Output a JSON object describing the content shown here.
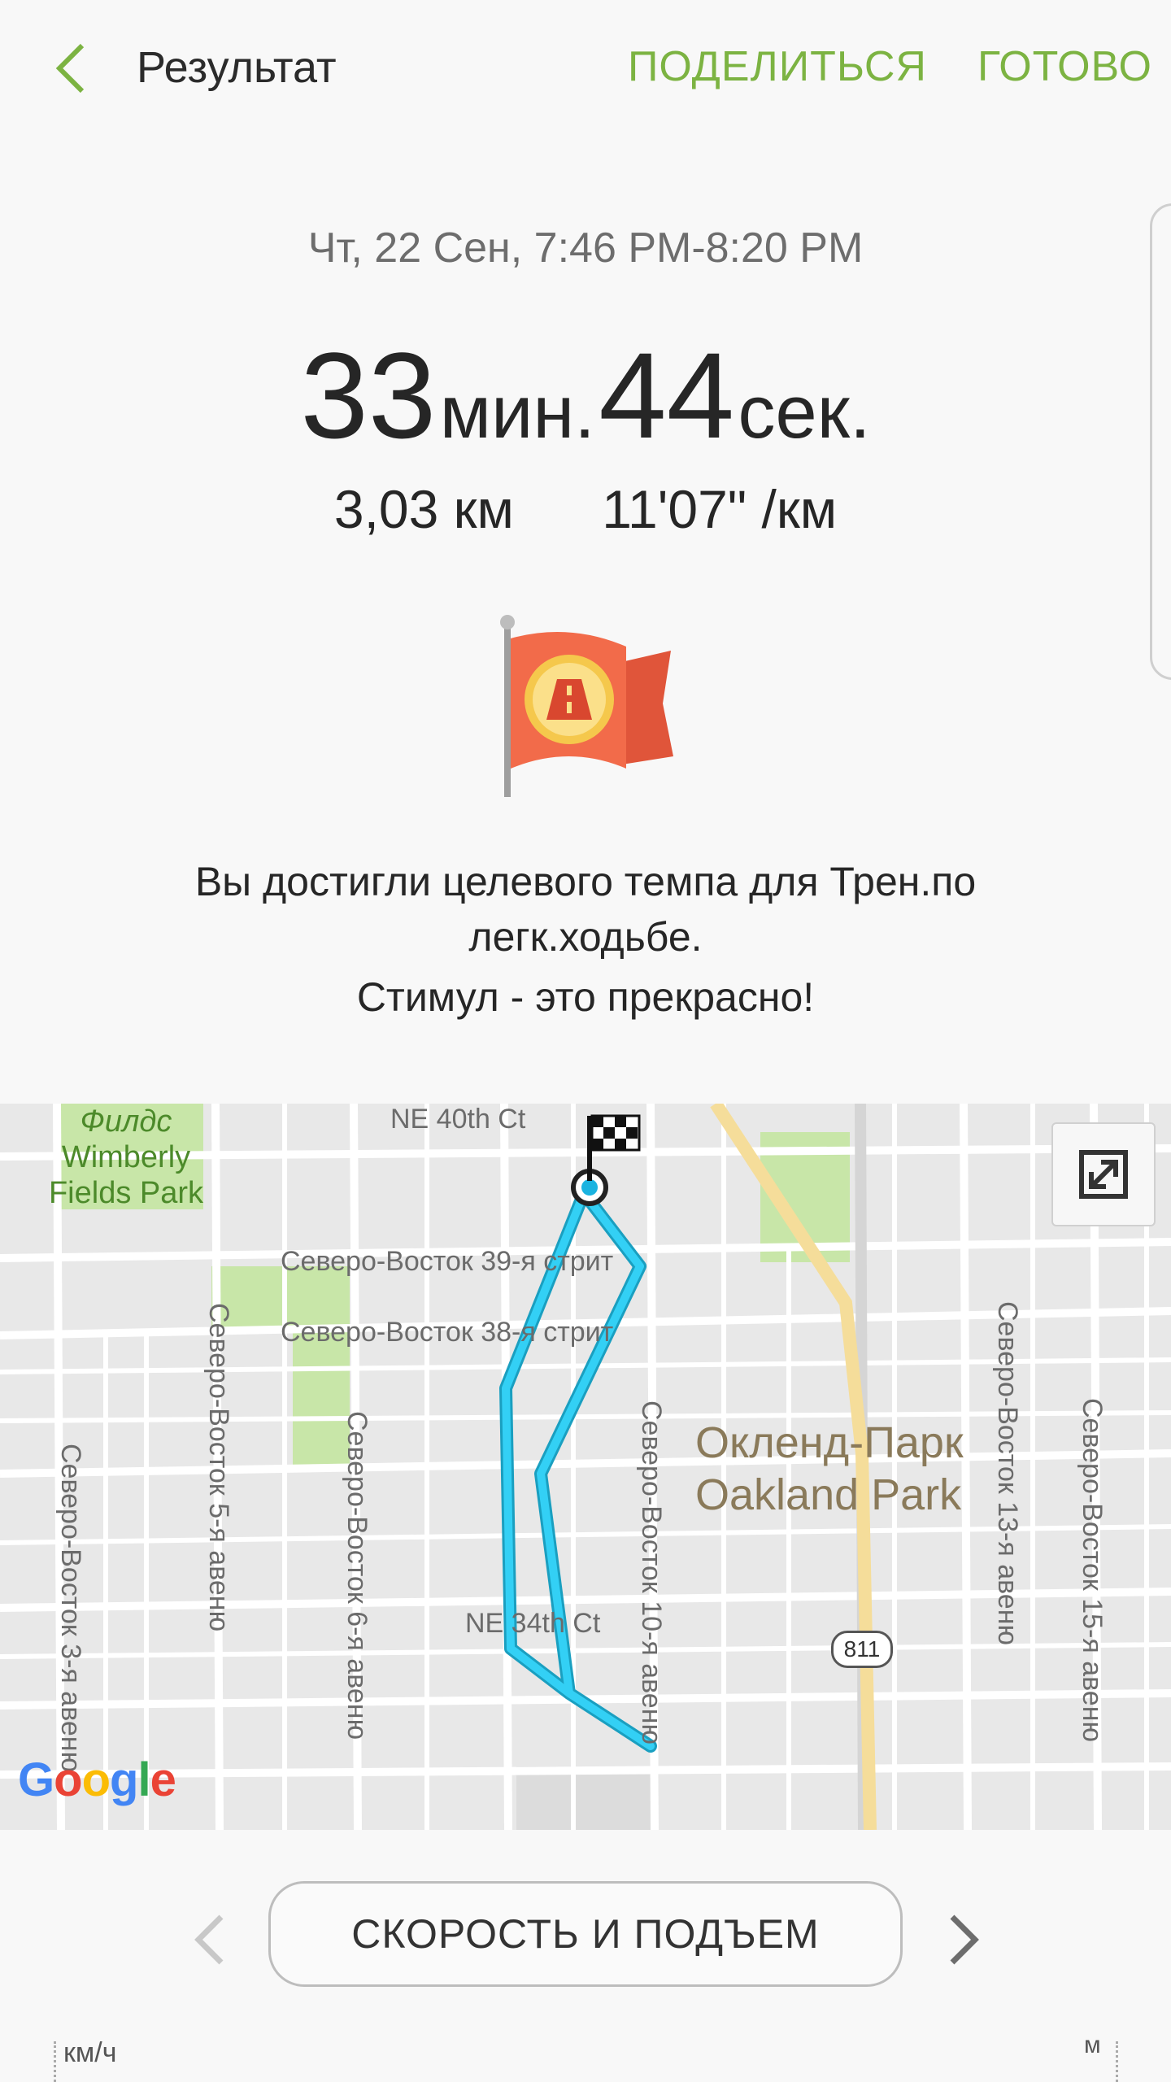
{
  "header": {
    "title": "Результат",
    "share_label": "ПОДЕЛИТЬСЯ",
    "done_label": "ГОТОВО",
    "back_icon": "chevron-left-icon",
    "accent_color": "#7cb342"
  },
  "workout": {
    "date_range": "Чт, 22 Сен, 7:46 PM-8:20 PM",
    "minutes": "33",
    "minutes_unit": "мин.",
    "seconds": "44",
    "seconds_unit": "сек.",
    "distance": "3,03 км",
    "pace": "11'07\" /км",
    "badge_icon": "achievement-flag-icon",
    "message_line1": "Вы достигли целевого темпа для Трен.по легк.ходьбе.",
    "message_line2": "Стимул - это прекрасно!"
  },
  "map": {
    "labels": {
      "ne40": "NE 40th Ct",
      "ne39": "Северо-Восток 39-я стрит",
      "ne38": "Северо-Восток 38-я стрит",
      "ne34": "NE 34th Ct",
      "ave3": "Северо-Восток 3-я авеню",
      "ave5": "Северо-Восток 5-я авеню",
      "ave6": "Северо-Восток 6-я авеню",
      "ave10": "Северо-Восток 10-я авеню",
      "ave13": "Северо-Восток 13-я авеню",
      "ave15": "Северо-Восток 15-я авеню"
    },
    "park": [
      "Филдс",
      "Wimberly",
      "Fields Park"
    ],
    "city_ru": "Окленд-Парк",
    "city_en": "Oakland Park",
    "route_number": "811",
    "attribution": [
      "G",
      "o",
      "o",
      "g",
      "l",
      "e"
    ],
    "route_color": "#29c5f0",
    "expand_icon": "expand-icon",
    "finish_icon": "checkered-flag-icon"
  },
  "chart_nav": {
    "label": "СКОРОСТЬ И ПОДЪЕМ",
    "prev_icon": "chevron-left-icon",
    "next_icon": "chevron-right-icon",
    "left_unit": "км/ч",
    "right_unit": "м"
  }
}
